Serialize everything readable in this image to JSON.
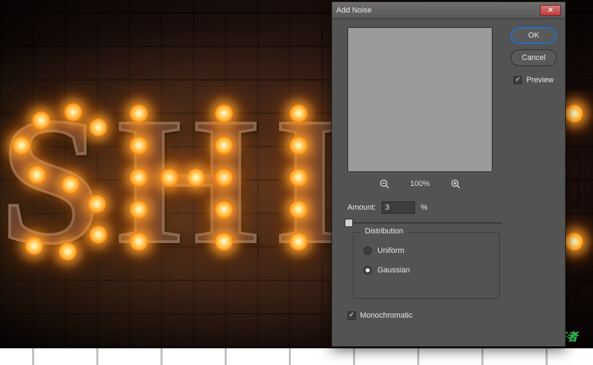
{
  "dialog": {
    "title": "Add Noise",
    "ok_label": "OK",
    "cancel_label": "Cancel",
    "preview_label": "Preview",
    "preview_checked": true,
    "zoom_level": "100%",
    "amount_label": "Amount:",
    "amount_value": "3",
    "amount_unit": "%",
    "distribution": {
      "legend": "Distribution",
      "options": [
        {
          "label": "Uniform",
          "selected": false
        },
        {
          "label": "Gaussian",
          "selected": true
        }
      ]
    },
    "monochromatic_label": "Monochromatic",
    "monochromatic_checked": true
  },
  "background_text": "SHI",
  "watermark": "PS 爱好者"
}
